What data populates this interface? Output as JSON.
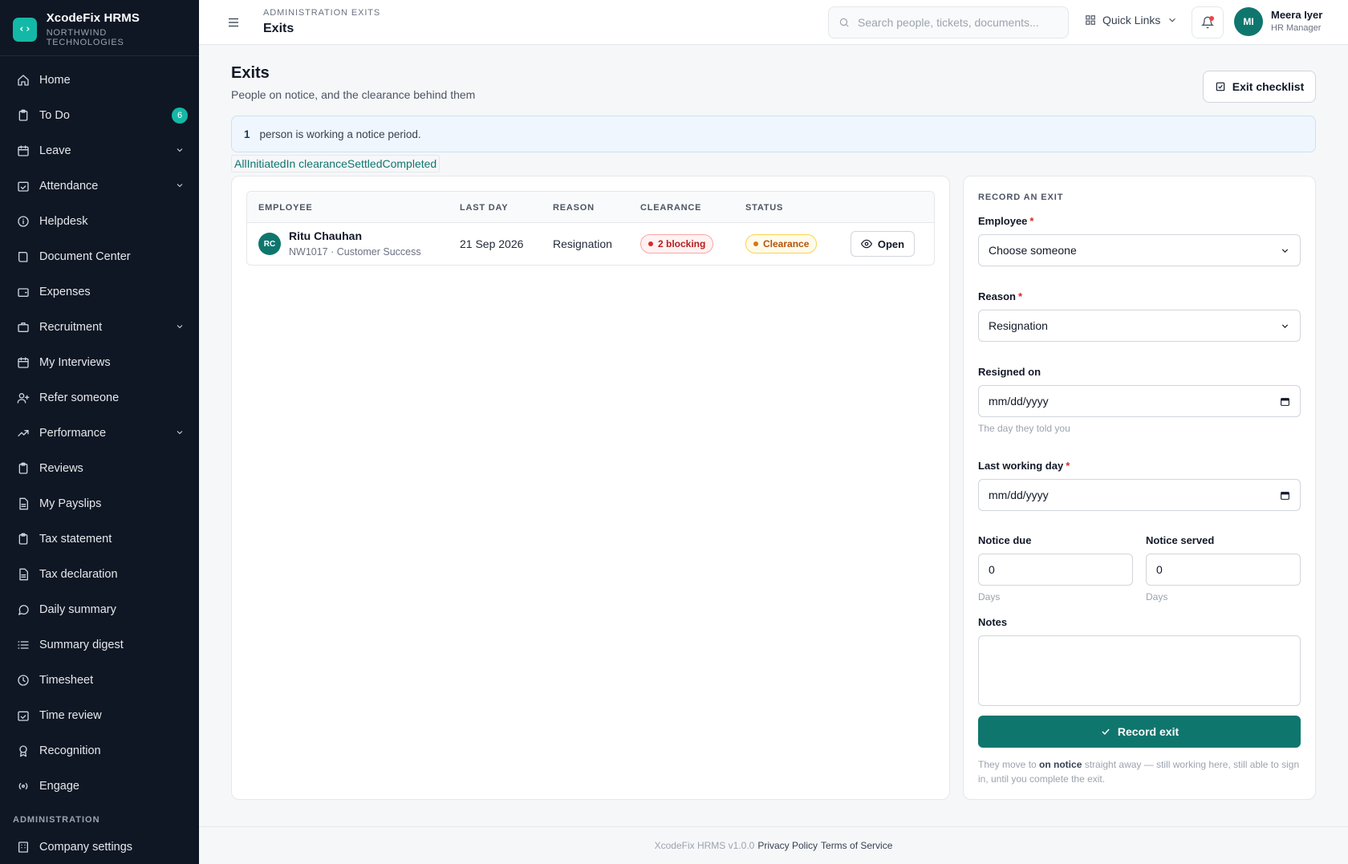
{
  "brand": {
    "title": "XcodeFix HRMS",
    "subtitle": "NORTHWIND TECHNOLOGIES",
    "logo_icon": "code-brackets-icon"
  },
  "sidebar": {
    "items": [
      {
        "label": "Home",
        "icon": "home-icon"
      },
      {
        "label": "To Do",
        "icon": "clipboard-icon",
        "badge": "6"
      },
      {
        "label": "Leave",
        "icon": "calendar-icon",
        "expandable": true
      },
      {
        "label": "Attendance",
        "icon": "calendar-check-icon",
        "expandable": true
      },
      {
        "label": "Helpdesk",
        "icon": "info-icon"
      },
      {
        "label": "Document Center",
        "icon": "book-icon"
      },
      {
        "label": "Expenses",
        "icon": "wallet-icon"
      },
      {
        "label": "Recruitment",
        "icon": "briefcase-icon",
        "expandable": true
      },
      {
        "label": "My Interviews",
        "icon": "calendar-icon"
      },
      {
        "label": "Refer someone",
        "icon": "user-plus-icon"
      },
      {
        "label": "Performance",
        "icon": "trending-up-icon",
        "expandable": true
      },
      {
        "label": "Reviews",
        "icon": "clipboard-icon"
      },
      {
        "label": "My Payslips",
        "icon": "file-icon"
      },
      {
        "label": "Tax statement",
        "icon": "clipboard-icon"
      },
      {
        "label": "Tax declaration",
        "icon": "file-icon"
      },
      {
        "label": "Daily summary",
        "icon": "message-icon"
      },
      {
        "label": "Summary digest",
        "icon": "list-icon"
      },
      {
        "label": "Timesheet",
        "icon": "clock-icon"
      },
      {
        "label": "Time review",
        "icon": "calendar-check-icon"
      },
      {
        "label": "Recognition",
        "icon": "award-icon"
      },
      {
        "label": "Engage",
        "icon": "broadcast-icon"
      }
    ],
    "section_label": "ADMINISTRATION",
    "admin_items": [
      {
        "label": "Company settings",
        "icon": "building-icon"
      }
    ]
  },
  "header": {
    "breadcrumb": "ADMINISTRATION EXITS",
    "title": "Exits",
    "search_placeholder": "Search people, tickets, documents...",
    "quick_links": "Quick Links",
    "user": {
      "initials": "MI",
      "name": "Meera Iyer",
      "role": "HR Manager"
    }
  },
  "main": {
    "title": "Exits",
    "subtitle": "People on notice, and the clearance behind them",
    "checklist_button": "Exit checklist",
    "notice": {
      "count": "1",
      "text": "person is working a notice period."
    },
    "tabs": [
      "All",
      "Initiated",
      "In clearance",
      "Settled",
      "Completed"
    ],
    "table": {
      "columns": [
        "EMPLOYEE",
        "LAST DAY",
        "REASON",
        "CLEARANCE",
        "STATUS"
      ],
      "rows": [
        {
          "initials": "RC",
          "name": "Ritu Chauhan",
          "meta": "NW1017 · Customer Success",
          "last_day": "21 Sep 2026",
          "reason": "Resignation",
          "clearance": "2 blocking",
          "status": "Clearance",
          "action": "Open"
        }
      ]
    }
  },
  "form": {
    "title": "RECORD AN EXIT",
    "employee_label": "Employee",
    "employee_value": "Choose someone",
    "reason_label": "Reason",
    "reason_value": "Resignation",
    "resigned_label": "Resigned on",
    "resigned_placeholder": "mm/dd/yyyy",
    "resigned_help": "The day they told you",
    "lastday_label": "Last working day",
    "lastday_placeholder": "mm/dd/yyyy",
    "notice_due_label": "Notice due",
    "notice_due_value": "0",
    "notice_due_help": "Days",
    "notice_served_label": "Notice served",
    "notice_served_value": "0",
    "notice_served_help": "Days",
    "notes_label": "Notes",
    "submit": "Record exit",
    "note_prefix": "They move to ",
    "note_bold": "on notice",
    "note_suffix": " straight away — still working here, still able to sign in, until you complete the exit."
  },
  "footer": {
    "version": "XcodeFix HRMS v1.0.0",
    "privacy": "Privacy Policy",
    "terms": "Terms of Service"
  },
  "colors": {
    "accent": "#0f766e",
    "sidebar_bg": "#0f1724",
    "danger": "#dc2626",
    "warning": "#d97706"
  }
}
